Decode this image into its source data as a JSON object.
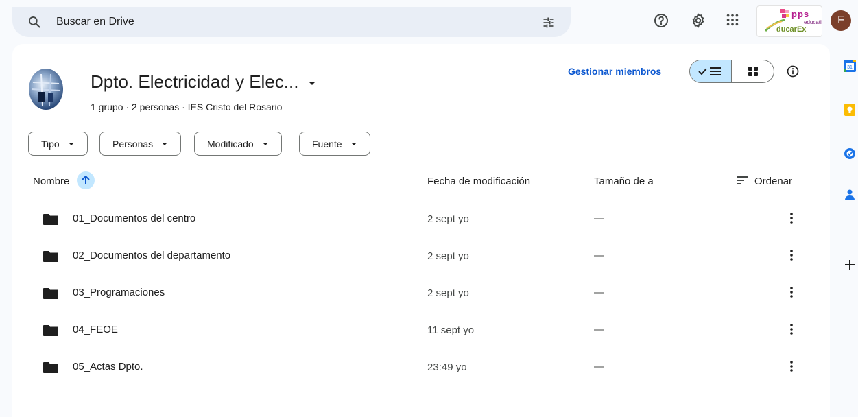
{
  "search": {
    "placeholder": "Buscar en Drive"
  },
  "branding": {
    "line1": "pps",
    "line2": "educativas",
    "line3": "ducarEx"
  },
  "user": {
    "initial": "F"
  },
  "group": {
    "title": "Dpto. Electricidad y Elec...",
    "subtitle": "1 grupo · 2 personas · IES Cristo del Rosario",
    "manage_label": "Gestionar miembros"
  },
  "filters": [
    {
      "label": "Tipo"
    },
    {
      "label": "Personas"
    },
    {
      "label": "Modificado"
    },
    {
      "label": "Fuente"
    }
  ],
  "table": {
    "columns": {
      "name": "Nombre",
      "modified": "Fecha de modificación",
      "size": "Tamaño de a",
      "sort": "Ordenar"
    },
    "rows": [
      {
        "name": "01_Documentos del centro",
        "modified": "2 sept yo",
        "size": "—"
      },
      {
        "name": "02_Documentos del departamento",
        "modified": "2 sept yo",
        "size": "—"
      },
      {
        "name": "03_Programaciones",
        "modified": "2 sept yo",
        "size": "—"
      },
      {
        "name": "04_FEOE",
        "modified": "11 sept yo",
        "size": "—"
      },
      {
        "name": "05_Actas Dpto.",
        "modified": "23:49 yo",
        "size": "—"
      }
    ]
  },
  "icons": {
    "search": "search-icon",
    "tune": "tune-icon",
    "help": "help-icon",
    "settings": "gear-icon",
    "apps": "apps-grid-icon",
    "info": "info-icon",
    "folder": "folder-icon",
    "more": "more-vert-icon"
  },
  "colors": {
    "accent": "#0b57d0",
    "selected": "#c2e7ff",
    "background": "#f8fafd"
  }
}
